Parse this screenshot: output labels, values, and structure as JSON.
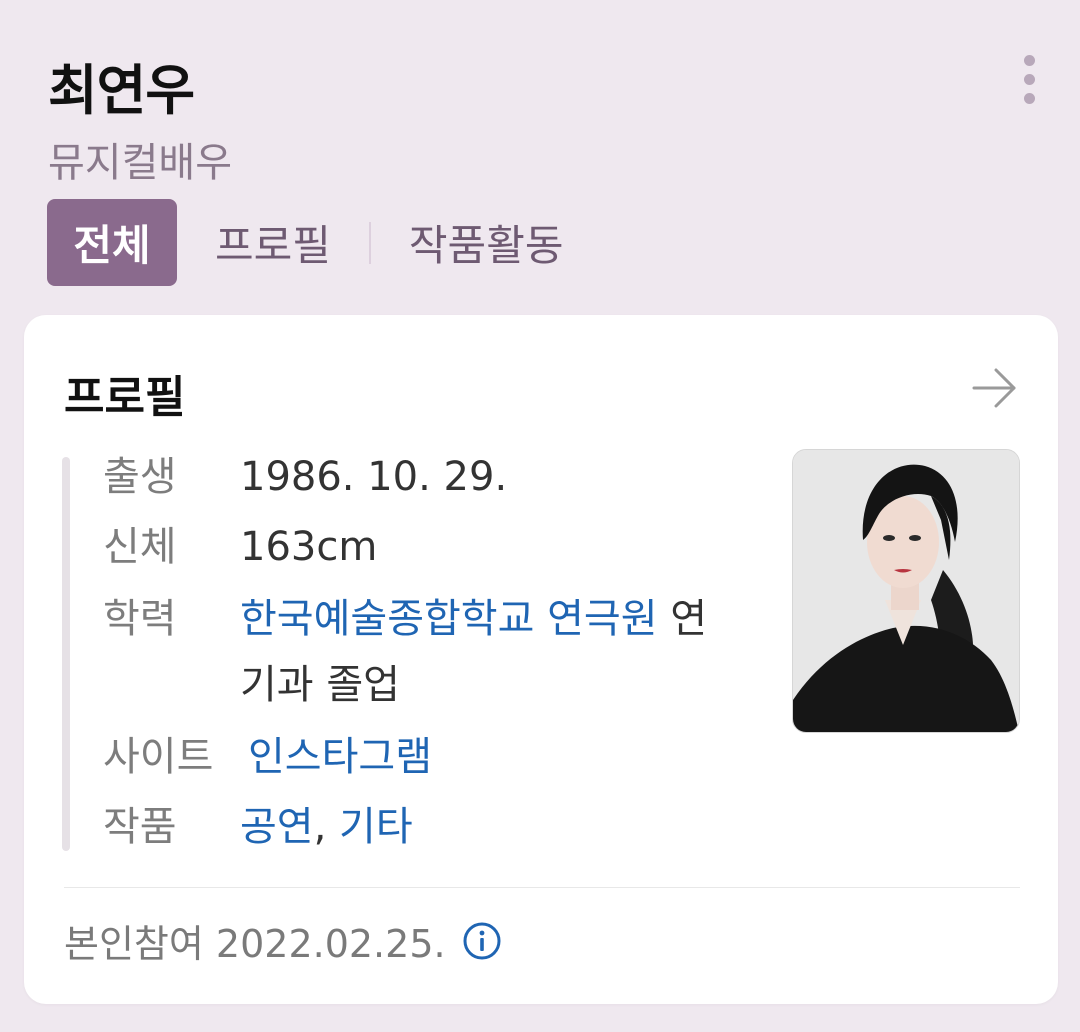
{
  "header": {
    "name": "최연우",
    "subtitle": "뮤지컬배우",
    "more_icon": "more-vertical-icon"
  },
  "tabs": [
    {
      "label": "전체",
      "active": true
    },
    {
      "label": "프로필",
      "active": false
    },
    {
      "label": "작품활동",
      "active": false
    }
  ],
  "profile": {
    "title": "프로필",
    "arrow_icon": "arrow-right-icon",
    "birth": {
      "label": "출생",
      "value": "1986. 10. 29."
    },
    "body": {
      "label": "신체",
      "value": "163cm"
    },
    "education": {
      "label": "학력",
      "link": "한국예술종합학교 연극원",
      "rest1": " 연",
      "rest2": "기과 졸업"
    },
    "site": {
      "label": "사이트",
      "link": "인스타그램"
    },
    "works": {
      "label": "작품",
      "link1": "공연",
      "sep": ", ",
      "link2": "기타"
    },
    "footer": "본인참여 2022.02.25.",
    "info_icon": "info-circle-icon"
  },
  "colors": {
    "background": "#efe8ef",
    "accent": "#8a6a8d",
    "link": "#1f65b3"
  }
}
